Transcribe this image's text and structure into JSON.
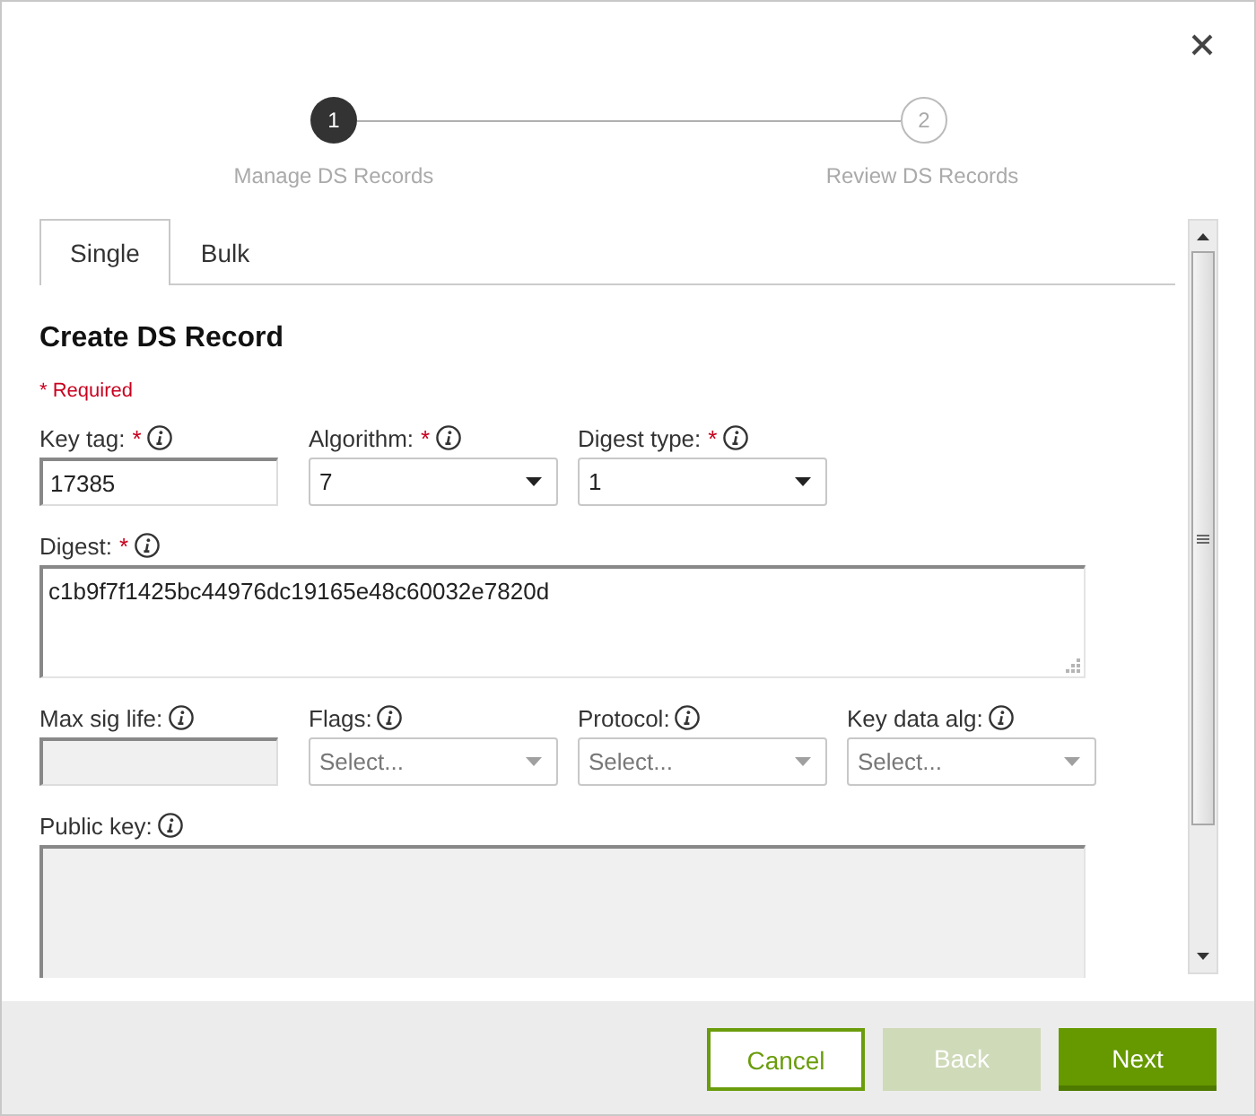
{
  "stepper": {
    "steps": [
      {
        "number": "1",
        "label": "Manage DS Records",
        "selected": true
      },
      {
        "number": "2",
        "label": "Review DS Records",
        "selected": false
      }
    ]
  },
  "tabs": [
    {
      "label": "Single",
      "selected": true
    },
    {
      "label": "Bulk",
      "selected": false
    }
  ],
  "form": {
    "title": "Create DS Record",
    "required_note": "* Required",
    "fields": [
      {
        "kind": "text",
        "label": "Key tag:",
        "required_mark": "*",
        "value": "17385",
        "disabled": false
      },
      {
        "kind": "select",
        "label": "Algorithm:",
        "required_mark": "*",
        "value": "7",
        "disabled": false
      },
      {
        "kind": "select",
        "label": "Digest type:",
        "required_mark": "*",
        "value": "1",
        "disabled": false
      },
      {
        "kind": "textarea",
        "label": "Digest:",
        "required_mark": "*",
        "value": "c1b9f7f1425bc44976dc19165e48c60032e7820d",
        "disabled": false
      },
      {
        "kind": "text",
        "label": "Max sig life:",
        "disabled": true
      },
      {
        "kind": "select",
        "label": "Flags:",
        "placeholder": "Select...",
        "disabled": false
      },
      {
        "kind": "select",
        "label": "Protocol:",
        "placeholder": "Select...",
        "disabled": false
      },
      {
        "kind": "select",
        "label": "Key data alg:",
        "placeholder": "Select...",
        "disabled": false
      },
      {
        "kind": "textarea",
        "label": "Public key:",
        "disabled": true
      }
    ]
  },
  "buttons": [
    {
      "label": "Cancel",
      "kind": "secondary",
      "disabled": false
    },
    {
      "label": "Back",
      "kind": "primary",
      "disabled": true
    },
    {
      "label": "Next",
      "kind": "primary",
      "disabled": false
    }
  ]
}
